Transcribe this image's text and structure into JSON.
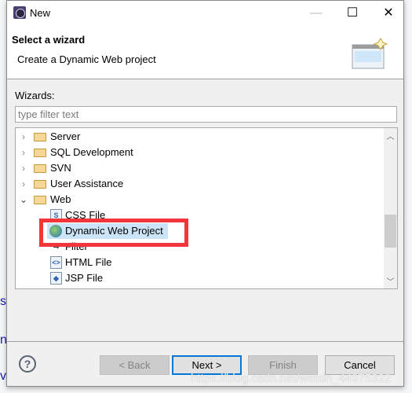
{
  "window": {
    "title": "New",
    "minimize_icon": "minimize-icon",
    "maximize_icon": "maximize-icon",
    "close_icon": "close-icon"
  },
  "header": {
    "title": "Select a wizard",
    "description": "Create a Dynamic Web project"
  },
  "wizards_label": "Wizards:",
  "filter": {
    "placeholder": "type filter text",
    "value": ""
  },
  "tree": {
    "items": [
      {
        "label": "Server",
        "type": "folder",
        "expanded": false
      },
      {
        "label": "SQL Development",
        "type": "folder",
        "expanded": false
      },
      {
        "label": "SVN",
        "type": "folder",
        "expanded": false
      },
      {
        "label": "User Assistance",
        "type": "folder",
        "expanded": false
      },
      {
        "label": "Web",
        "type": "folder",
        "expanded": true
      },
      {
        "label": "CSS File",
        "type": "file",
        "icon": "css-file-icon"
      },
      {
        "label": "Dynamic Web Project",
        "type": "file",
        "icon": "dynamic-web-project-icon",
        "selected": true
      },
      {
        "label": "Filter",
        "type": "file",
        "icon": "filter-icon"
      },
      {
        "label": "HTML File",
        "type": "file",
        "icon": "html-file-icon"
      },
      {
        "label": "JSP File",
        "type": "file",
        "icon": "jsp-file-icon"
      }
    ]
  },
  "buttons": {
    "back": "< Back",
    "next": "Next >",
    "finish": "Finish",
    "cancel": "Cancel"
  },
  "highlight_color": "#f2363a",
  "watermark": "https://blog.csdn.net/weixin_44975322"
}
